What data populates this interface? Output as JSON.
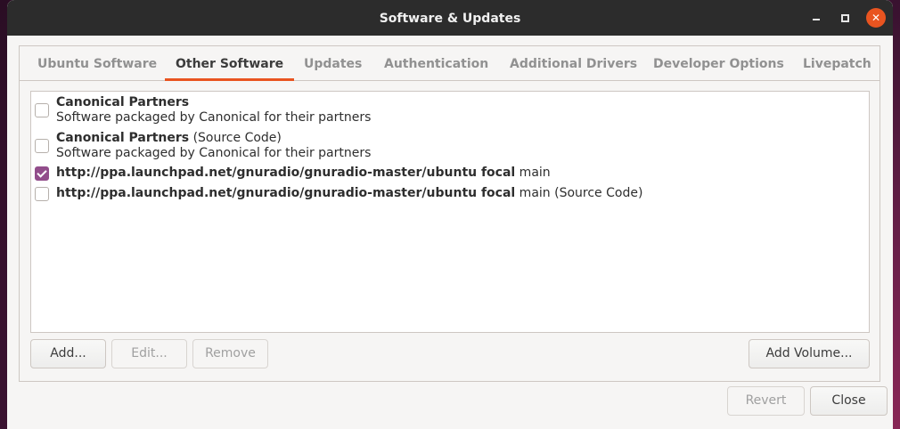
{
  "window": {
    "title": "Software & Updates"
  },
  "tabs": [
    {
      "label": "Ubuntu Software",
      "active": false
    },
    {
      "label": "Other Software",
      "active": true
    },
    {
      "label": "Updates",
      "active": false
    },
    {
      "label": "Authentication",
      "active": false
    },
    {
      "label": "Additional Drivers",
      "active": false
    },
    {
      "label": "Developer Options",
      "active": false
    },
    {
      "label": "Livepatch",
      "active": false
    }
  ],
  "sources": [
    {
      "name": "Canonical Partners",
      "suffix": "",
      "description": "Software packaged by Canonical for their partners",
      "checked": false
    },
    {
      "name": "Canonical Partners",
      "suffix": " (Source Code)",
      "description": "Software packaged by Canonical for their partners",
      "checked": false
    },
    {
      "name": "http://ppa.launchpad.net/gnuradio/gnuradio-master/ubuntu focal",
      "suffix": " main",
      "description": "",
      "checked": true
    },
    {
      "name": "http://ppa.launchpad.net/gnuradio/gnuradio-master/ubuntu focal",
      "suffix": " main (Source Code)",
      "description": "",
      "checked": false
    }
  ],
  "buttons": {
    "add": "Add...",
    "edit": "Edit...",
    "remove": "Remove",
    "add_volume": "Add Volume...",
    "revert": "Revert",
    "close": "Close"
  },
  "colors": {
    "accent": "#e95420",
    "checkbox": "#924d8b",
    "titlebar": "#2c2c2c"
  }
}
